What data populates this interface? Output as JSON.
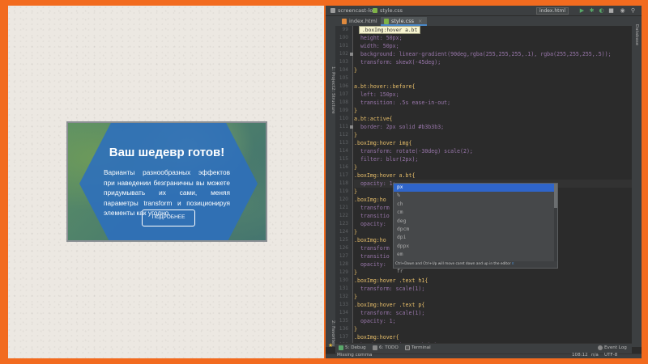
{
  "preview": {
    "title": "Ваш шедевр готов!",
    "description": "Варианты разнообразных эффектов при наведении безграничны вы можете придумывать их сами, меняя параметры transform и позиционируя элементы как угодно.",
    "button_label": "ПОДРОБНЕЕ"
  },
  "ide": {
    "breadcrumb": [
      "screencast-loc",
      "style.css"
    ],
    "run_config": "index.html",
    "tabs": [
      {
        "label": "index.html",
        "active": false
      },
      {
        "label": "style.css",
        "active": true
      }
    ],
    "left_tool_windows": [
      "1: Project",
      "2: Structure",
      "2: Favorites"
    ],
    "right_tool_windows": [
      "Database"
    ],
    "tooltip": ".boxImg:hover a.bt",
    "lines": [
      {
        "n": "99",
        "text": "  left: -70px;"
      },
      {
        "n": "100",
        "text": "  height: 50px;"
      },
      {
        "n": "101",
        "text": "  width: 50px;"
      },
      {
        "n": "102",
        "text": "  background: linear-gradient(90deg,rgba(255,255,255,.1), rgba(255,255,255,.5));"
      },
      {
        "n": "103",
        "text": "  transform: skewX(-45deg);"
      },
      {
        "n": "104",
        "text": "}"
      },
      {
        "n": "105",
        "text": ""
      },
      {
        "n": "106",
        "text": "a.bt:hover::before{"
      },
      {
        "n": "107",
        "text": "  left: 150px;"
      },
      {
        "n": "108",
        "text": "  transition: .5s ease-in-out;"
      },
      {
        "n": "109",
        "text": "}"
      },
      {
        "n": "110",
        "text": "a.bt:active{"
      },
      {
        "n": "111",
        "text": "  border: 2px solid #b3b3b3;"
      },
      {
        "n": "112",
        "text": "}"
      },
      {
        "n": "113",
        "text": ".boxImg:hover img{"
      },
      {
        "n": "114",
        "text": "  transform: rotate(-30deg) scale(2);"
      },
      {
        "n": "115",
        "text": "  filter: blur(2px);"
      },
      {
        "n": "116",
        "text": "}"
      },
      {
        "n": "117",
        "text": ".boxImg:hover a.bt{"
      },
      {
        "n": "118",
        "text": "  opacity: 1;"
      },
      {
        "n": "119",
        "text": "}"
      },
      {
        "n": "120",
        "text": ".boxImg:ho"
      },
      {
        "n": "121",
        "text": "  transform"
      },
      {
        "n": "122",
        "text": "  transitio"
      },
      {
        "n": "123",
        "text": "  opacity:"
      },
      {
        "n": "124",
        "text": "}"
      },
      {
        "n": "125",
        "text": ".boxImg:ho"
      },
      {
        "n": "126",
        "text": "  transform"
      },
      {
        "n": "127",
        "text": "  transitio"
      },
      {
        "n": "128",
        "text": "  opacity:"
      },
      {
        "n": "129",
        "text": "}"
      },
      {
        "n": "130",
        "text": ".boxImg:hover .text h1{"
      },
      {
        "n": "131",
        "text": "  transform: scale(1);"
      },
      {
        "n": "132",
        "text": "}"
      },
      {
        "n": "133",
        "text": ".boxImg:hover .text p{"
      },
      {
        "n": "134",
        "text": "  transform: scale(1);"
      },
      {
        "n": "135",
        "text": "  opacity: 1;"
      },
      {
        "n": "136",
        "text": "}"
      },
      {
        "n": "137",
        "text": ".boxImg:hover{"
      },
      {
        "n": "138",
        "text": "  border: 5px inset #b7bab7;"
      },
      {
        "n": "139",
        "text": "}"
      }
    ],
    "autocomplete": {
      "items": [
        "px",
        "%",
        "ch",
        "cm",
        "deg",
        "dpcm",
        "dpi",
        "dppx",
        "em",
        "ex",
        "fr"
      ],
      "selected": "px",
      "hint": "Ctrl+Down and Ctrl+Up will move caret down and up in the editor",
      "hint_link": "π"
    },
    "bottom_tools": [
      "5: Debug",
      "6: TODO",
      "Terminal",
      "Event Log"
    ],
    "status": {
      "message": "Missing comma",
      "position": "108:12",
      "line_sep": "n/a",
      "encoding": "UTF-8"
    },
    "colors": {
      "accent": "#2f65ca",
      "frame": "#f26b1f",
      "card_blue": "#2c6ebe"
    }
  }
}
